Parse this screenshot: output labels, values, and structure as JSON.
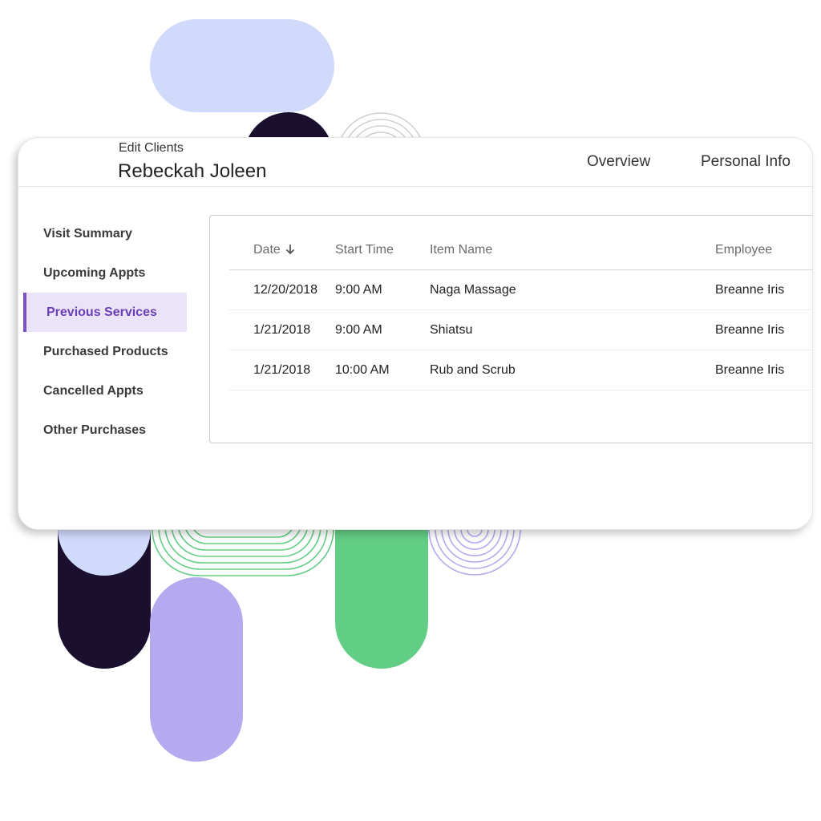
{
  "header": {
    "subtitle": "Edit Clients",
    "client_name": "Rebeckah Joleen",
    "tabs": [
      "Overview",
      "Personal Info"
    ]
  },
  "sidebar": {
    "items": [
      {
        "label": "Visit Summary",
        "active": false
      },
      {
        "label": "Upcoming Appts",
        "active": false
      },
      {
        "label": "Previous Services",
        "active": true
      },
      {
        "label": "Purchased Products",
        "active": false
      },
      {
        "label": "Cancelled Appts",
        "active": false
      },
      {
        "label": "Other Purchases",
        "active": false
      }
    ]
  },
  "table": {
    "columns": [
      "Date",
      "Start Time",
      "Item Name",
      "Employee"
    ],
    "sort_icon": "arrow-down-icon",
    "rows": [
      [
        "12/20/2018",
        "9:00 AM",
        "Naga Massage",
        "Breanne Iris"
      ],
      [
        "1/21/2018",
        "9:00 AM",
        "Shiatsu",
        "Breanne Iris"
      ],
      [
        "1/21/2018",
        "10:00 AM",
        "Rub and Scrub",
        "Breanne Iris"
      ]
    ]
  },
  "colors": {
    "accent": "#7a52c7",
    "active_bg": "#ebe4f8",
    "decor_light_blue": "#d0dbfb",
    "decor_navy": "#1a0f2e",
    "decor_lavender": "#b5aaf0",
    "decor_green": "#62cd85"
  }
}
